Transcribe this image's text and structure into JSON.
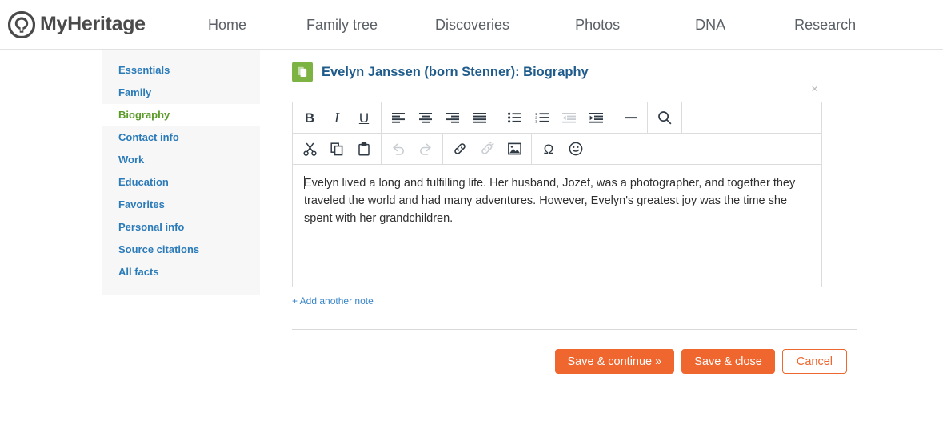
{
  "brand": {
    "name": "MyHeritage",
    "logo_icon": "myheritage-tree-logo"
  },
  "nav": {
    "items": [
      {
        "label": "Home",
        "key": "home"
      },
      {
        "label": "Family tree",
        "key": "family-tree"
      },
      {
        "label": "Discoveries",
        "key": "discoveries"
      },
      {
        "label": "Photos",
        "key": "photos"
      },
      {
        "label": "DNA",
        "key": "dna"
      },
      {
        "label": "Research",
        "key": "research"
      }
    ]
  },
  "sidebar": {
    "items": [
      {
        "label": "Essentials",
        "selected": false
      },
      {
        "label": "Family",
        "selected": false
      },
      {
        "label": "Biography",
        "selected": true
      },
      {
        "label": "Contact info",
        "selected": false
      },
      {
        "label": "Work",
        "selected": false
      },
      {
        "label": "Education",
        "selected": false
      },
      {
        "label": "Favorites",
        "selected": false
      },
      {
        "label": "Personal info",
        "selected": false
      },
      {
        "label": "Source citations",
        "selected": false
      },
      {
        "label": "All facts",
        "selected": false
      }
    ]
  },
  "header": {
    "title": "Evelyn Janssen (born Stenner): Biography",
    "title_icon": "document-pages-icon",
    "close_label": "×"
  },
  "editor": {
    "toolbar_row1": [
      {
        "name": "bold-icon",
        "label": "B",
        "disabled": false
      },
      {
        "name": "italic-icon",
        "label": "I",
        "disabled": false
      },
      {
        "name": "underline-icon",
        "label": "U",
        "disabled": false
      },
      {
        "name": "align-left-icon",
        "label": "",
        "disabled": false
      },
      {
        "name": "align-center-icon",
        "label": "",
        "disabled": false
      },
      {
        "name": "align-right-icon",
        "label": "",
        "disabled": false
      },
      {
        "name": "align-justify-icon",
        "label": "",
        "disabled": false
      },
      {
        "name": "bullet-list-icon",
        "label": "",
        "disabled": false
      },
      {
        "name": "numbered-list-icon",
        "label": "",
        "disabled": false
      },
      {
        "name": "outdent-icon",
        "label": "",
        "disabled": true
      },
      {
        "name": "indent-icon",
        "label": "",
        "disabled": false
      },
      {
        "name": "horizontal-rule-icon",
        "label": "",
        "disabled": false
      },
      {
        "name": "search-icon",
        "label": "",
        "disabled": false
      }
    ],
    "toolbar_row2": [
      {
        "name": "cut-icon",
        "label": "",
        "disabled": false
      },
      {
        "name": "copy-icon",
        "label": "",
        "disabled": false
      },
      {
        "name": "paste-icon",
        "label": "",
        "disabled": false
      },
      {
        "name": "undo-icon",
        "label": "",
        "disabled": true
      },
      {
        "name": "redo-icon",
        "label": "",
        "disabled": true
      },
      {
        "name": "link-icon",
        "label": "",
        "disabled": false
      },
      {
        "name": "unlink-icon",
        "label": "",
        "disabled": true
      },
      {
        "name": "insert-image-icon",
        "label": "",
        "disabled": false
      },
      {
        "name": "special-character-icon",
        "label": "Ω",
        "disabled": false
      },
      {
        "name": "emoji-icon",
        "label": "☺",
        "disabled": false
      }
    ],
    "body_text": "Evelyn lived a long and fulfilling life. Her husband, Jozef, was a photographer, and together they traveled the world and had many adventures. However, Evelyn's greatest joy was the time she spent with her grandchildren.",
    "add_note_label": "+ Add another note"
  },
  "footer": {
    "save_continue_label": "Save & continue »",
    "save_close_label": "Save & close",
    "cancel_label": "Cancel"
  },
  "colors": {
    "accent_orange": "#f0662f",
    "link_blue": "#2b7bb9",
    "selected_green": "#5a9a27",
    "title_blue": "#1f5c8b",
    "title_icon_green": "#7db343"
  }
}
